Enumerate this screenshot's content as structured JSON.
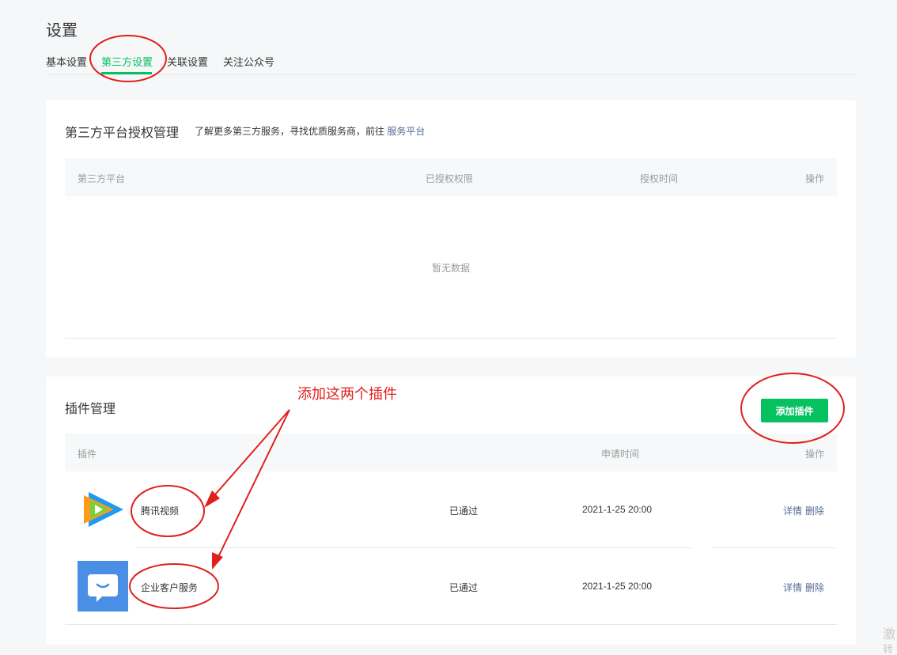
{
  "page": {
    "title": "设置"
  },
  "tabs": [
    {
      "label": "基本设置",
      "active": false
    },
    {
      "label": "第三方设置",
      "active": true
    },
    {
      "label": "关联设置",
      "active": false
    },
    {
      "label": "关注公众号",
      "active": false
    }
  ],
  "third_party": {
    "title": "第三方平台授权管理",
    "desc_prefix": "了解更多第三方服务，寻找优质服务商，前往",
    "desc_link": "服务平台",
    "columns": [
      "第三方平台",
      "已授权权限",
      "授权时间",
      "操作"
    ],
    "empty_text": "暂无数据"
  },
  "plugins": {
    "title": "插件管理",
    "add_button": "添加插件",
    "columns": [
      "插件",
      "申请时间",
      "操作"
    ],
    "rows": [
      {
        "icon": "tencent-video-logo",
        "name": "腾讯视频",
        "status": "已通过",
        "time": "2021-1-25 20:00",
        "detail": "详情",
        "delete": "删除"
      },
      {
        "icon": "enterprise-service-logo",
        "name": "企业客户服务",
        "status": "已通过",
        "time": "2021-1-25 20:00",
        "detail": "详情",
        "delete": "删除"
      }
    ]
  },
  "annotation": {
    "text": "添加这两个插件",
    "color": "#e0201b"
  },
  "edge_text": [
    "激",
    "转"
  ],
  "colors": {
    "accent": "#07c160",
    "link": "#576b95",
    "annotation": "#e0201b"
  }
}
